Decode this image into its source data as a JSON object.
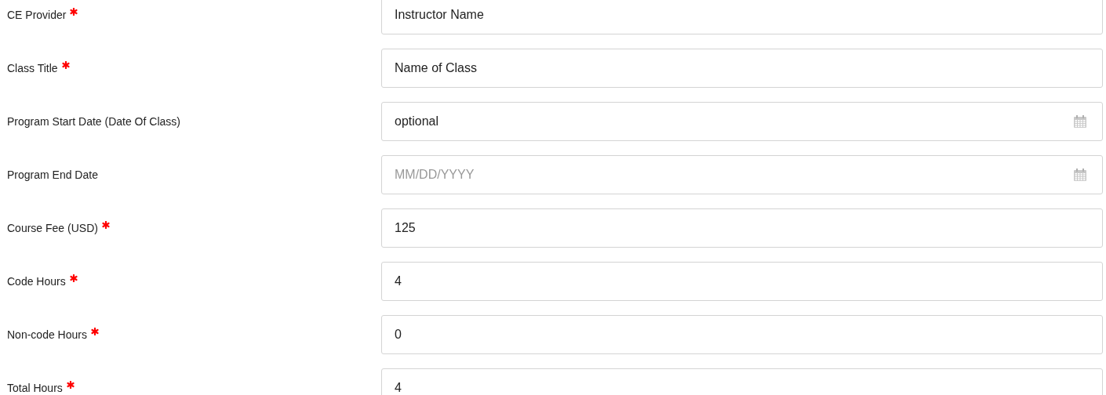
{
  "fields": [
    {
      "label": "CE Provider",
      "required": true,
      "kind": "text",
      "value": "Instructor Name"
    },
    {
      "label": "Class Title",
      "required": true,
      "kind": "text",
      "value": "Name of Class"
    },
    {
      "label": "Program Start Date (Date Of Class)",
      "required": false,
      "kind": "date",
      "value": "optional"
    },
    {
      "label": "Program End Date",
      "required": false,
      "kind": "date",
      "placeholder": "MM/DD/YYYY"
    },
    {
      "label": "Course Fee (USD)",
      "required": true,
      "kind": "text",
      "value": "125"
    },
    {
      "label": "Code Hours",
      "required": true,
      "kind": "text",
      "value": "4"
    },
    {
      "label": "Non-code Hours",
      "required": true,
      "kind": "text",
      "value": "0"
    },
    {
      "label": "Total Hours",
      "required": true,
      "kind": "text",
      "value": "4"
    }
  ]
}
